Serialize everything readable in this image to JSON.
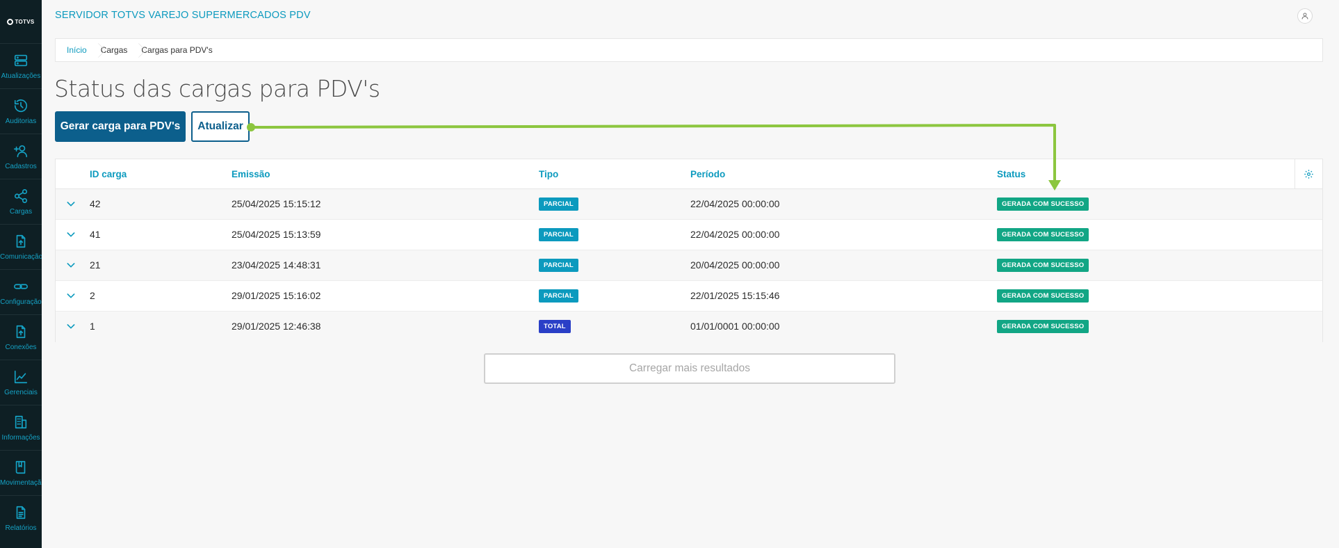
{
  "brand": {
    "logo_text": "TOTVS"
  },
  "sidebar": {
    "items": [
      {
        "label": "Atualizações",
        "icon": "server-icon"
      },
      {
        "label": "Auditorias",
        "icon": "history-icon"
      },
      {
        "label": "Cadastros",
        "icon": "add-user-icon"
      },
      {
        "label": "Cargas",
        "icon": "share-icon"
      },
      {
        "label": "Comunicação",
        "icon": "file-upload-icon"
      },
      {
        "label": "Configuração",
        "icon": "link-icon"
      },
      {
        "label": "Conexões",
        "icon": "file-upload-icon"
      },
      {
        "label": "Gerenciais",
        "icon": "chart-line-icon"
      },
      {
        "label": "Informações",
        "icon": "building-icon"
      },
      {
        "label": "Movimentação",
        "icon": "book-icon"
      },
      {
        "label": "Relatórios",
        "icon": "document-icon"
      }
    ]
  },
  "header": {
    "title": "SERVIDOR TOTVS VAREJO SUPERMERCADOS PDV"
  },
  "breadcrumb": [
    "Início",
    "Cargas",
    "Cargas para PDV's"
  ],
  "page": {
    "title": "Status das cargas para PDV's",
    "primary_button": "Gerar carga para PDV's",
    "secondary_button": "Atualizar",
    "load_more": "Carregar mais resultados"
  },
  "table": {
    "columns": [
      "ID carga",
      "Emissão",
      "Tipo",
      "Período",
      "Status"
    ],
    "rows": [
      {
        "id": "42",
        "emissao": "25/04/2025 15:15:12",
        "tipo": "PARCIAL",
        "periodo": "22/04/2025 00:00:00",
        "status": "GERADA COM SUCESSO"
      },
      {
        "id": "41",
        "emissao": "25/04/2025 15:13:59",
        "tipo": "PARCIAL",
        "periodo": "22/04/2025 00:00:00",
        "status": "GERADA COM SUCESSO"
      },
      {
        "id": "21",
        "emissao": "23/04/2025 14:48:31",
        "tipo": "PARCIAL",
        "periodo": "20/04/2025 00:00:00",
        "status": "GERADA COM SUCESSO"
      },
      {
        "id": "2",
        "emissao": "29/01/2025 15:16:02",
        "tipo": "PARCIAL",
        "periodo": "22/01/2025 15:15:46",
        "status": "GERADA COM SUCESSO"
      },
      {
        "id": "1",
        "emissao": "29/01/2025 12:46:38",
        "tipo": "TOTAL",
        "periodo": "01/01/0001 00:00:00",
        "status": "GERADA COM SUCESSO"
      }
    ]
  },
  "colors": {
    "accent": "#0c9abe",
    "primary": "#0c5f8c",
    "success": "#12a685",
    "total": "#2a3fc7",
    "annotation": "#8cc63f"
  }
}
